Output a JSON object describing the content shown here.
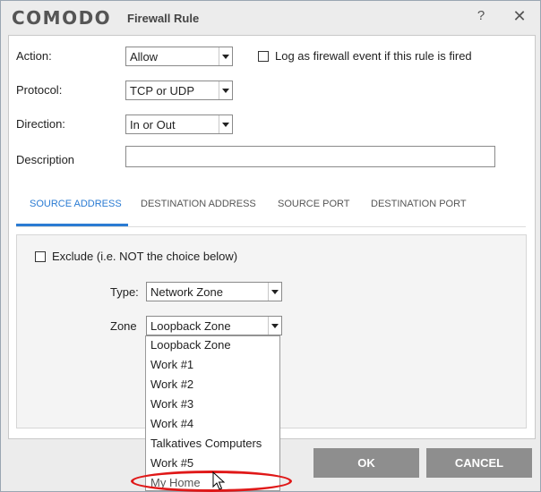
{
  "window": {
    "brand": "COMODO",
    "title": "Firewall Rule",
    "help_glyph": "?",
    "close_glyph": "✕"
  },
  "form": {
    "action_label": "Action:",
    "action_value": "Allow",
    "log_label": "Log as firewall event if this rule is fired",
    "log_checked": false,
    "protocol_label": "Protocol:",
    "protocol_value": "TCP or UDP",
    "direction_label": "Direction:",
    "direction_value": "In or Out",
    "description_label": "Description",
    "description_value": ""
  },
  "tabs": {
    "active": "SOURCE ADDRESS",
    "items": [
      "SOURCE ADDRESS",
      "DESTINATION ADDRESS",
      "SOURCE PORT",
      "DESTINATION PORT"
    ]
  },
  "source": {
    "exclude_label": "Exclude (i.e. NOT the choice below)",
    "exclude_checked": false,
    "type_label": "Type:",
    "type_value": "Network Zone",
    "zone_label": "Zone",
    "zone_value": "Loopback Zone"
  },
  "zone_dropdown": {
    "options": [
      "Loopback Zone",
      "Work #1",
      "Work #2",
      "Work #3",
      "Work #4",
      "Talkatives Computers",
      "Work #5",
      "My Home"
    ],
    "hovered": "My Home"
  },
  "buttons": {
    "ok": "OK",
    "cancel": "CANCEL"
  },
  "colors": {
    "accent": "#2a7bd3",
    "button_bg": "#8e8e8e",
    "highlight": "#e01818"
  }
}
